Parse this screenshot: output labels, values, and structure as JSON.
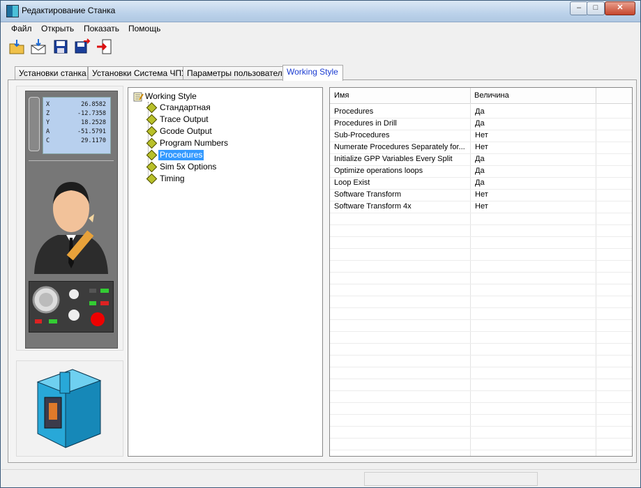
{
  "window": {
    "title": "Редактирование Станка",
    "minimize": "‒",
    "maximize": "□",
    "close": "✕"
  },
  "menu": [
    "Файл",
    "Открыть",
    "Показать",
    "Помощь"
  ],
  "toolbar": [
    "open-icon",
    "import-icon",
    "save-icon",
    "save-as-icon",
    "exit-icon"
  ],
  "tabs": [
    "Установки станка",
    "Установки Система ЧПУ",
    "Параметры пользователя",
    "Working Style"
  ],
  "active_tab": "Working Style",
  "dro": [
    {
      "axis": "X",
      "value": "26.8582"
    },
    {
      "axis": "Z",
      "value": "-12.7358"
    },
    {
      "axis": "Y",
      "value": "18.2528"
    },
    {
      "axis": "A",
      "value": "-51.5791"
    },
    {
      "axis": "C",
      "value": "29.1170"
    }
  ],
  "tree": {
    "root": "Working Style",
    "items": [
      "Стандартная",
      "Trace Output",
      "Gcode Output",
      "Program Numbers",
      "Procedures",
      "Sim 5x Options",
      "Timing"
    ],
    "selected": "Procedures"
  },
  "grid": {
    "columns": [
      "Имя",
      "Величина"
    ],
    "rows": [
      {
        "name": "Procedures",
        "value": "Да"
      },
      {
        "name": "Procedures in Drill",
        "value": "Да"
      },
      {
        "name": "Sub-Procedures",
        "value": "Нет"
      },
      {
        "name": "Numerate Procedures Separately for...",
        "value": "Нет"
      },
      {
        "name": "Initialize GPP Variables Every Split",
        "value": "Да"
      },
      {
        "name": "Optimize operations loops",
        "value": "Да"
      },
      {
        "name": "Loop Exist",
        "value": "Да"
      },
      {
        "name": "Software Transform",
        "value": "Нет"
      },
      {
        "name": "Software Transform 4x",
        "value": "Нет"
      }
    ]
  },
  "colors": {
    "selection": "#3399ff",
    "active_tab_text": "#1a3bd1",
    "tree_node": "#b9c12a"
  }
}
